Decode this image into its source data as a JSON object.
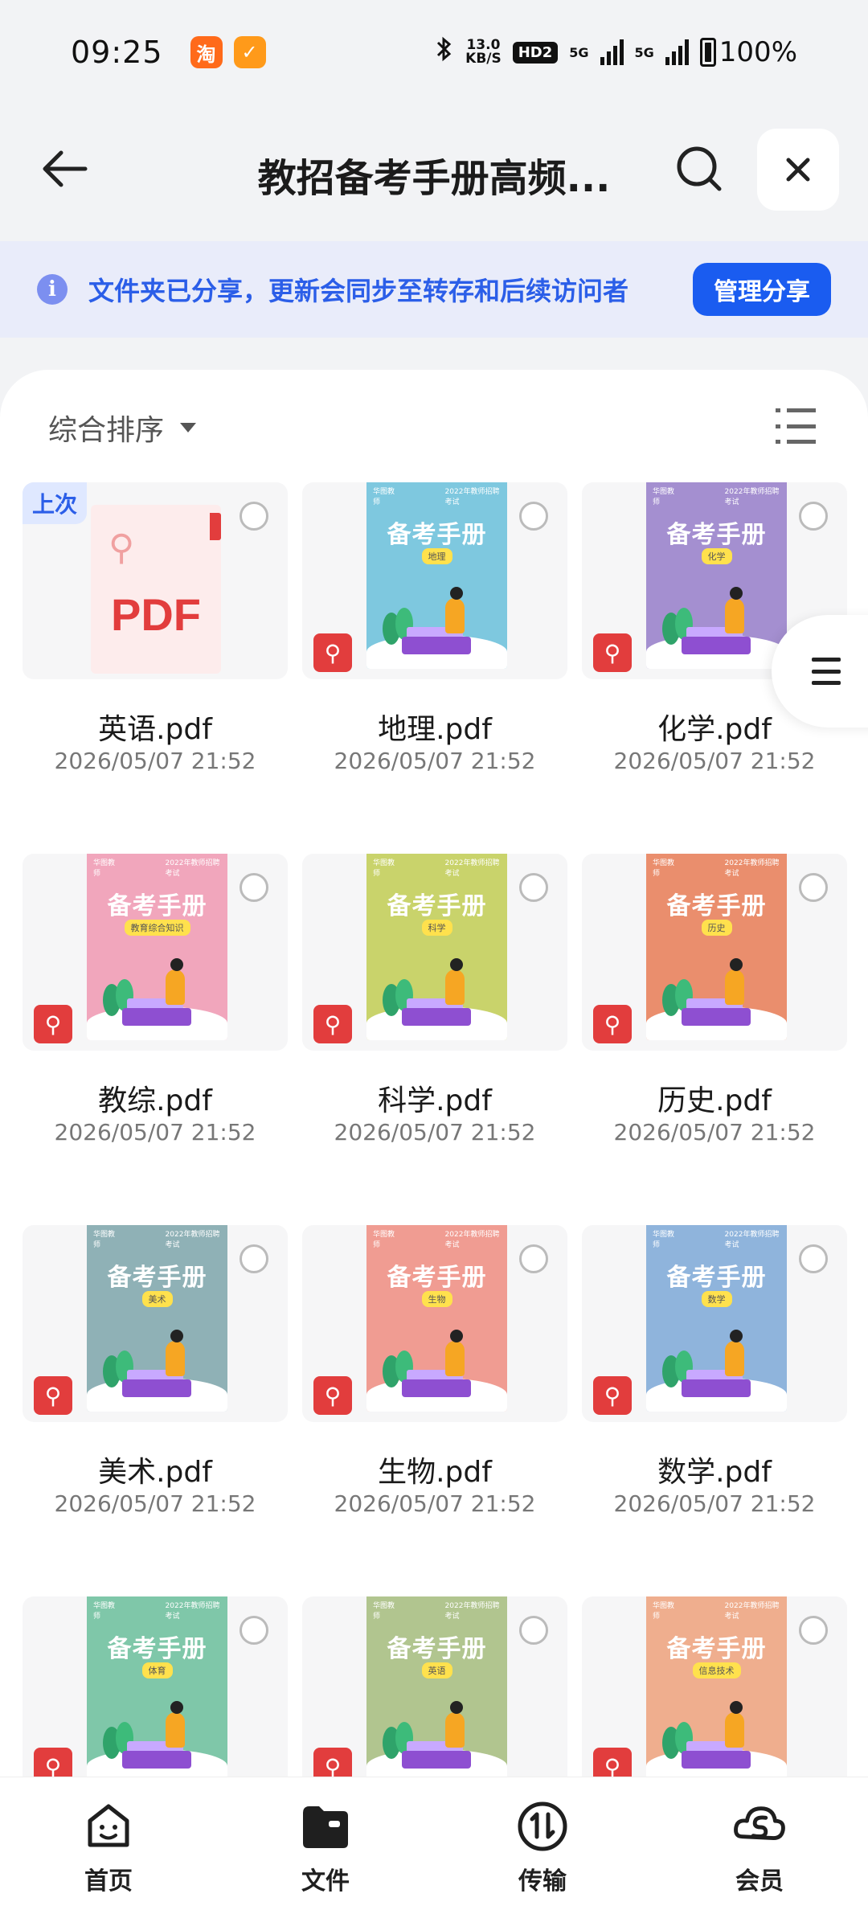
{
  "status_bar": {
    "time": "09:25",
    "net_speed_value": "13.0",
    "net_speed_unit": "KB/S",
    "hd_badge": "HD2",
    "signal1": "5G",
    "signal2": "5G",
    "battery": "100%",
    "app_icon_1": "淘",
    "app_icon_2": "✓"
  },
  "header": {
    "title": "教招备考手册高频...",
    "back_icon": "arrow-left",
    "search_icon": "search",
    "close_icon": "close"
  },
  "share_banner": {
    "text": "文件夹已分享，更新会同步至转存和后续访问者",
    "button": "管理分享"
  },
  "toolbar": {
    "sort_label": "综合排序"
  },
  "files": [
    {
      "name": "英语.pdf",
      "date": "2026/05/07 21:52",
      "badge": "上次",
      "cover": "pdf"
    },
    {
      "name": "地理.pdf",
      "date": "2026/05/07 21:52",
      "cover_color": "#7ec8df",
      "cover_title": "备考手册",
      "cover_sub": "地理"
    },
    {
      "name": "化学.pdf",
      "date": "2026/05/07 21:52",
      "cover_color": "#a48fd0",
      "cover_title": "备考手册",
      "cover_sub": "化学"
    },
    {
      "name": "教综.pdf",
      "date": "2026/05/07 21:52",
      "cover_color": "#f1a6bc",
      "cover_title": "备考手册",
      "cover_sub": "教育综合知识"
    },
    {
      "name": "科学.pdf",
      "date": "2026/05/07 21:52",
      "cover_color": "#c9d36b",
      "cover_title": "备考手册",
      "cover_sub": "科学"
    },
    {
      "name": "历史.pdf",
      "date": "2026/05/07 21:52",
      "cover_color": "#ea8e6d",
      "cover_title": "备考手册",
      "cover_sub": "历史"
    },
    {
      "name": "美术.pdf",
      "date": "2026/05/07 21:52",
      "cover_color": "#8fb1b6",
      "cover_title": "备考手册",
      "cover_sub": "美术"
    },
    {
      "name": "生物.pdf",
      "date": "2026/05/07 21:52",
      "cover_color": "#f09c92",
      "cover_title": "备考手册",
      "cover_sub": "生物"
    },
    {
      "name": "数学.pdf",
      "date": "2026/05/07 21:52",
      "cover_color": "#8fb4dc",
      "cover_title": "备考手册",
      "cover_sub": "数学"
    },
    {
      "name": "",
      "date": "",
      "cover_color": "#7fc7a9",
      "cover_title": "备考手册",
      "cover_sub": "体育"
    },
    {
      "name": "",
      "date": "",
      "cover_color": "#b1c58f",
      "cover_title": "备考手册",
      "cover_sub": "英语"
    },
    {
      "name": "",
      "date": "",
      "cover_color": "#efae8e",
      "cover_title": "备考手册",
      "cover_sub": "信息技术"
    }
  ],
  "cover_header_left": "华图教师",
  "cover_header_right": "2022年教师招聘考试",
  "pdf_label": "PDF",
  "bottom_nav": [
    {
      "label": "首页",
      "icon": "home-face"
    },
    {
      "label": "文件",
      "icon": "folder"
    },
    {
      "label": "传输",
      "icon": "transfer"
    },
    {
      "label": "会员",
      "icon": "vip"
    }
  ],
  "colors": {
    "accent": "#1a5cf0",
    "banner_bg": "#e9ecfa",
    "pdf_red": "#e23d3d"
  }
}
